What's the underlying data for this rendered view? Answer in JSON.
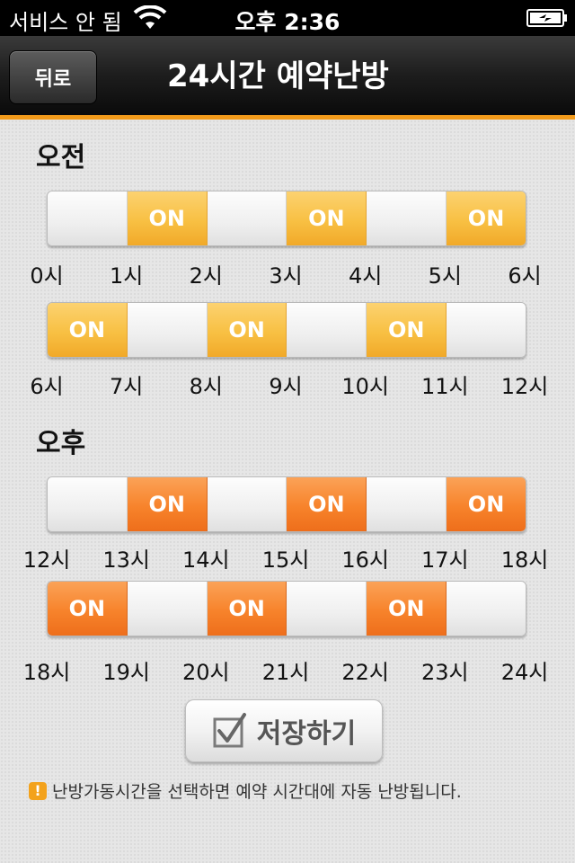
{
  "status_bar": {
    "carrier": "서비스 안 됨",
    "time": "오후 2:36",
    "wifi_icon": "wifi-icon",
    "battery_icon": "battery-charging-icon"
  },
  "nav": {
    "back_label": "뒤로",
    "title": "24시간 예약난방"
  },
  "colors": {
    "am_on": "#f8c043",
    "pm_on": "#f7832b",
    "nav_accent": "#f29a1a"
  },
  "am": {
    "title": "오전",
    "rows": [
      {
        "segments": [
          "",
          "ON",
          "",
          "ON",
          "",
          "ON"
        ],
        "ticks": [
          "0시",
          "1시",
          "2시",
          "3시",
          "4시",
          "5시",
          "6시"
        ]
      },
      {
        "segments": [
          "ON",
          "",
          "ON",
          "",
          "ON",
          ""
        ],
        "ticks": [
          "6시",
          "7시",
          "8시",
          "9시",
          "10시",
          "11시",
          "12시"
        ]
      }
    ]
  },
  "pm": {
    "title": "오후",
    "rows": [
      {
        "segments": [
          "",
          "ON",
          "",
          "ON",
          "",
          "ON"
        ],
        "ticks": [
          "12시",
          "13시",
          "14시",
          "15시",
          "16시",
          "17시",
          "18시"
        ]
      },
      {
        "segments": [
          "ON",
          "",
          "ON",
          "",
          "ON",
          ""
        ],
        "ticks": [
          "18시",
          "19시",
          "20시",
          "21시",
          "22시",
          "23시",
          "24시"
        ]
      }
    ]
  },
  "save_button": {
    "label": "저장하기",
    "icon": "checkbox-icon"
  },
  "notice": {
    "icon": "warning-icon",
    "text": "난방가동시간을 선택하면 예약 시간대에 자동 난방됩니다."
  }
}
